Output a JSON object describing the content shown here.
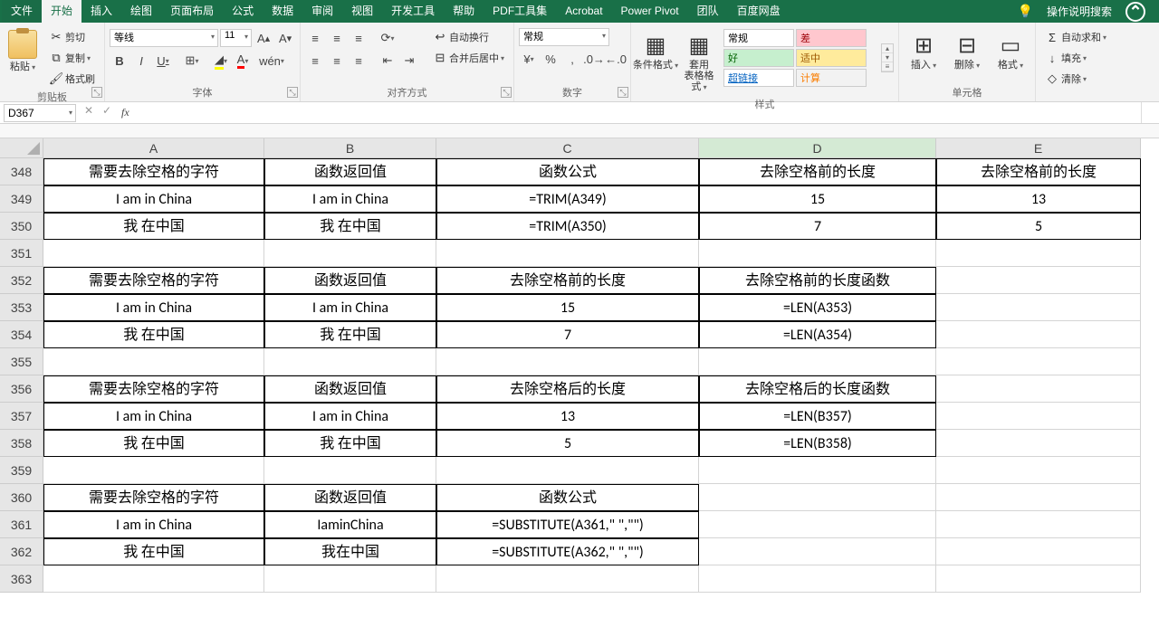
{
  "tabs": {
    "file": "文件",
    "home": "开始",
    "insert": "插入",
    "draw": "绘图",
    "layout": "页面布局",
    "formulas": "公式",
    "data": "数据",
    "review": "审阅",
    "view": "视图",
    "dev": "开发工具",
    "help": "帮助",
    "pdf": "PDF工具集",
    "acrobat": "Acrobat",
    "powerpivot": "Power Pivot",
    "team": "团队",
    "baidu": "百度网盘",
    "search": "操作说明搜索"
  },
  "ribbon": {
    "clipboard": {
      "label": "剪贴板",
      "paste": "粘贴",
      "cut": "剪切",
      "copy": "复制",
      "painter": "格式刷"
    },
    "font": {
      "label": "字体",
      "name": "等线",
      "size": "11"
    },
    "align": {
      "label": "对齐方式",
      "wrap": "自动换行",
      "merge": "合并后居中"
    },
    "number": {
      "label": "数字",
      "format": "常规"
    },
    "styles": {
      "label": "样式",
      "cond": "条件格式",
      "table": "套用\n表格格式",
      "normal": "常规",
      "bad": "差",
      "good": "好",
      "neutral": "适中",
      "link": "超链接",
      "calc": "计算"
    },
    "cells": {
      "label": "单元格",
      "insert": "插入",
      "delete": "删除",
      "format": "格式"
    },
    "editing": {
      "label": "",
      "autosum": "自动求和",
      "fill": "填充",
      "clear": "清除"
    }
  },
  "formula_bar": {
    "name_box": "D367",
    "fx": "fx",
    "formula": ""
  },
  "columns": [
    "A",
    "B",
    "C",
    "D",
    "E"
  ],
  "row_start": 348,
  "selected_col": "D",
  "grid": [
    {
      "r": 348,
      "A": "需要去除空格的字符",
      "B": "函数返回值",
      "C": "函数公式",
      "D": "去除空格前的长度",
      "E": "去除空格前的长度",
      "border": [
        "A",
        "B",
        "C",
        "D",
        "E"
      ]
    },
    {
      "r": 349,
      "A": "I am in China",
      "B": "I am in China",
      "C": "=TRIM(A349)",
      "D": "15",
      "E": "13",
      "border": [
        "A",
        "B",
        "C",
        "D",
        "E"
      ]
    },
    {
      "r": 350,
      "A": "我 在中国",
      "B": "我 在中国",
      "C": "=TRIM(A350)",
      "D": "7",
      "E": "5",
      "border": [
        "A",
        "B",
        "C",
        "D",
        "E"
      ]
    },
    {
      "r": 351
    },
    {
      "r": 352,
      "A": "需要去除空格的字符",
      "B": "函数返回值",
      "C": "去除空格前的长度",
      "D": "去除空格前的长度函数",
      "border": [
        "A",
        "B",
        "C",
        "D"
      ]
    },
    {
      "r": 353,
      "A": "I am in China",
      "B": "I am in China",
      "C": "15",
      "D": "=LEN(A353)",
      "border": [
        "A",
        "B",
        "C",
        "D"
      ]
    },
    {
      "r": 354,
      "A": "我 在中国",
      "B": "我 在中国",
      "C": "7",
      "D": "=LEN(A354)",
      "border": [
        "A",
        "B",
        "C",
        "D"
      ]
    },
    {
      "r": 355
    },
    {
      "r": 356,
      "A": "需要去除空格的字符",
      "B": "函数返回值",
      "C": "去除空格后的长度",
      "D": "去除空格后的长度函数",
      "border": [
        "A",
        "B",
        "C",
        "D"
      ]
    },
    {
      "r": 357,
      "A": "I am in China",
      "B": "I am in China",
      "C": "13",
      "D": "=LEN(B357)",
      "border": [
        "A",
        "B",
        "C",
        "D"
      ]
    },
    {
      "r": 358,
      "A": "我 在中国",
      "B": "我 在中国",
      "C": "5",
      "D": "=LEN(B358)",
      "border": [
        "A",
        "B",
        "C",
        "D"
      ]
    },
    {
      "r": 359
    },
    {
      "r": 360,
      "A": "需要去除空格的字符",
      "B": "函数返回值",
      "C": "函数公式",
      "border": [
        "A",
        "B",
        "C"
      ]
    },
    {
      "r": 361,
      "A": "I am in China",
      "B": "IaminChina",
      "C": "=SUBSTITUTE(A361,\" \",\"\")",
      "border": [
        "A",
        "B",
        "C"
      ]
    },
    {
      "r": 362,
      "A": "我 在中国",
      "B": "我在中国",
      "C": "=SUBSTITUTE(A362,\" \",\"\")",
      "border": [
        "A",
        "B",
        "C"
      ]
    },
    {
      "r": 363
    }
  ]
}
